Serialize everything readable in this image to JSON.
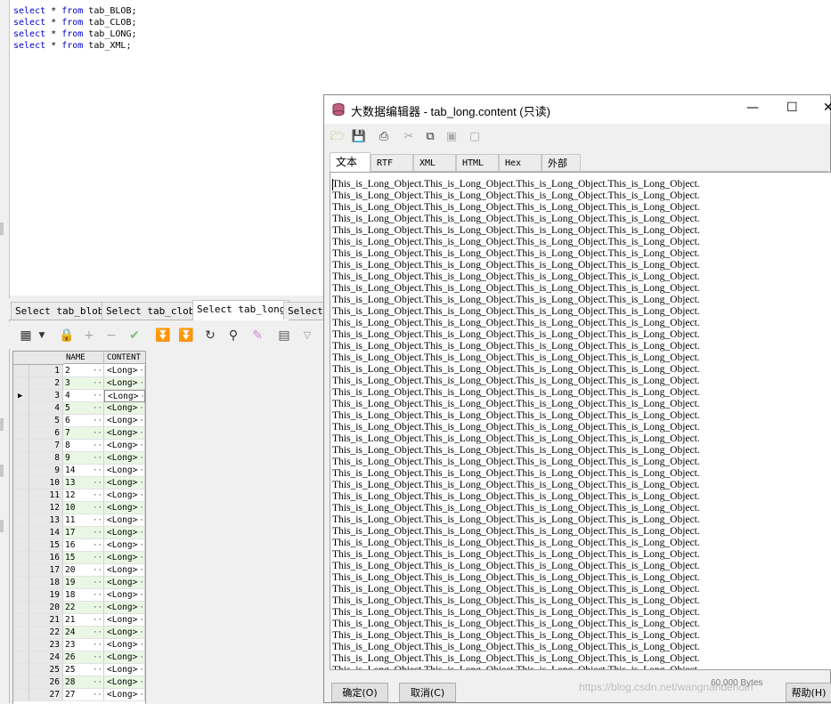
{
  "sql_lines": [
    {
      "kw1": "select",
      "mid1": " * ",
      "kw2": "from",
      "rest": " tab_BLOB;"
    },
    {
      "kw1": "select",
      "mid1": " * ",
      "kw2": "from",
      "rest": " tab_CLOB;"
    },
    {
      "kw1": "select",
      "mid1": " * ",
      "kw2": "from",
      "rest": " tab_LONG;"
    },
    {
      "kw1": "select",
      "mid1": " * ",
      "kw2": "from",
      "rest": " tab_XML;"
    }
  ],
  "result_tabs": [
    {
      "label": "Select tab_blob"
    },
    {
      "label": "Select tab_clob"
    },
    {
      "label": "Select tab_long"
    },
    {
      "label": "Select"
    }
  ],
  "grid": {
    "headers": {
      "name": "NAME",
      "content": "CONTENT"
    },
    "cell_dots": "···",
    "current_row_marker": "▶",
    "current_row": 3,
    "rows": [
      {
        "num": "1",
        "name": "2",
        "content": "<Long>"
      },
      {
        "num": "2",
        "name": "3",
        "content": "<Long>"
      },
      {
        "num": "3",
        "name": "4",
        "content": "<Long>"
      },
      {
        "num": "4",
        "name": "5",
        "content": "<Long>"
      },
      {
        "num": "5",
        "name": "6",
        "content": "<Long>"
      },
      {
        "num": "6",
        "name": "7",
        "content": "<Long>"
      },
      {
        "num": "7",
        "name": "8",
        "content": "<Long>"
      },
      {
        "num": "8",
        "name": "9",
        "content": "<Long>"
      },
      {
        "num": "9",
        "name": "14",
        "content": "<Long>"
      },
      {
        "num": "10",
        "name": "13",
        "content": "<Long>"
      },
      {
        "num": "11",
        "name": "12",
        "content": "<Long>"
      },
      {
        "num": "12",
        "name": "10",
        "content": "<Long>"
      },
      {
        "num": "13",
        "name": "11",
        "content": "<Long>"
      },
      {
        "num": "14",
        "name": "17",
        "content": "<Long>"
      },
      {
        "num": "15",
        "name": "16",
        "content": "<Long>"
      },
      {
        "num": "16",
        "name": "15",
        "content": "<Long>"
      },
      {
        "num": "17",
        "name": "20",
        "content": "<Long>"
      },
      {
        "num": "18",
        "name": "19",
        "content": "<Long>"
      },
      {
        "num": "19",
        "name": "18",
        "content": "<Long>"
      },
      {
        "num": "20",
        "name": "22",
        "content": "<Long>"
      },
      {
        "num": "21",
        "name": "21",
        "content": "<Long>"
      },
      {
        "num": "22",
        "name": "24",
        "content": "<Long>"
      },
      {
        "num": "23",
        "name": "23",
        "content": "<Long>"
      },
      {
        "num": "24",
        "name": "26",
        "content": "<Long>"
      },
      {
        "num": "25",
        "name": "25",
        "content": "<Long>"
      },
      {
        "num": "26",
        "name": "28",
        "content": "<Long>"
      },
      {
        "num": "27",
        "name": "27",
        "content": "<Long>"
      }
    ]
  },
  "dialog": {
    "title": "大数据编辑器 - tab_long.content (只读)",
    "win_minimize": "—",
    "win_maximize": "☐",
    "win_close": "✕",
    "tabs": [
      {
        "label": "文本"
      },
      {
        "label": "RTF"
      },
      {
        "label": "XML"
      },
      {
        "label": "HTML"
      },
      {
        "label": "Hex"
      },
      {
        "label": "外部"
      }
    ],
    "text_line": "This_is_Long_Object.This_is_Long_Object.This_is_Long_Object.This_is_Long_Object.",
    "bytes": "60,000 Bytes",
    "ok_button": "确定(O)",
    "cancel_button": "取消(C)",
    "help_button": "帮助(H)",
    "watermark": "https://blog.csdn.net/wangnandenoin"
  }
}
